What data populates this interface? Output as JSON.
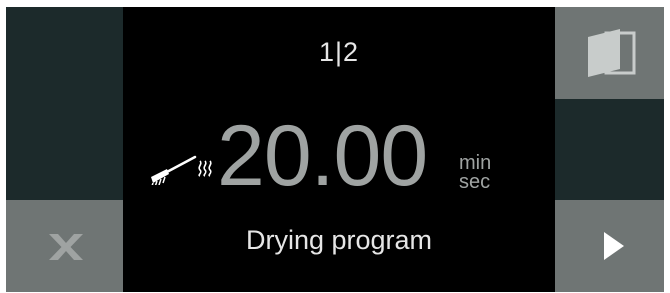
{
  "display": {
    "page_indicator": "1|2",
    "time_value": "20.00",
    "unit_top": "min",
    "unit_bottom": "sec",
    "program_name": "Drying program"
  },
  "buttons": {
    "cancel": {
      "icon": "x-icon"
    },
    "door": {
      "icon": "door-icon"
    },
    "next": {
      "icon": "play-arrow-icon"
    }
  },
  "icons": {
    "brush": "brush-icon",
    "heat": "heat-waves-icon"
  },
  "colors": {
    "screen_bg": "#000000",
    "button_active": "#6f7574",
    "button_inactive": "#1c2a2b",
    "text_primary": "#e6e6e6",
    "text_secondary": "#9fa3a2"
  }
}
